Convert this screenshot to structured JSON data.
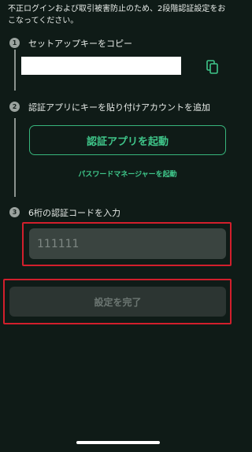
{
  "intro_text": "不正ログインおよび取引被害防止のため、2段階認証設定をおこなってください。",
  "steps": [
    {
      "number": "1",
      "label": "セットアップキーをコピー"
    },
    {
      "number": "2",
      "label": "認証アプリにキーを貼り付けアカウントを追加"
    },
    {
      "number": "3",
      "label": "6桁の認証コードを入力"
    }
  ],
  "setup_key": {
    "value": ""
  },
  "copy_icon": "copy-icon",
  "auth_app_button": {
    "label": "認証アプリを起動"
  },
  "password_manager_link": {
    "label": "パスワードマネージャーを起動"
  },
  "code_input": {
    "placeholder": "111111",
    "value": ""
  },
  "complete_button": {
    "label": "設定を完了"
  },
  "colors": {
    "background": "#0f1b17",
    "accent": "#3fc68a",
    "highlight": "#d21f2c",
    "disabled_button": "#2c3532"
  }
}
